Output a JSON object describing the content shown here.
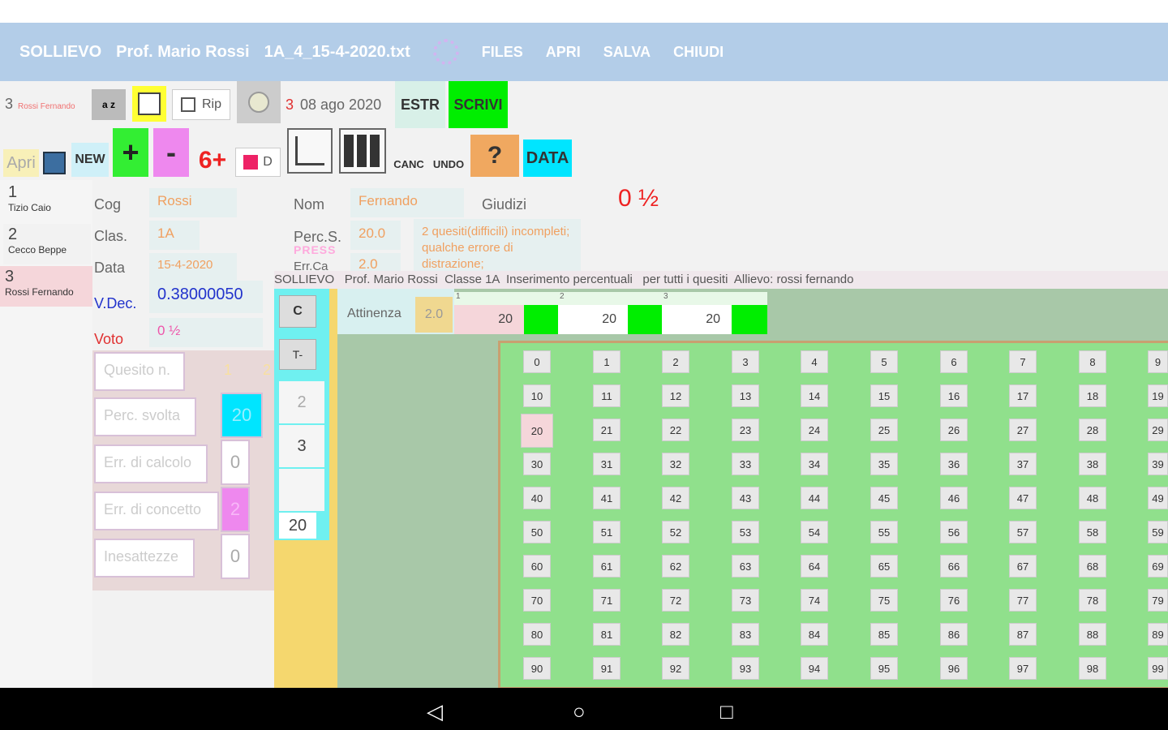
{
  "appbar": {
    "title": "SOLLIEVO",
    "teacher": "Prof. Mario Rossi",
    "file": "1A_4_15-4-2020.txt",
    "menu": [
      "FILES",
      "APRI",
      "SALVA",
      "CHIUDI"
    ]
  },
  "toolbar": {
    "count": "3",
    "current_student": "Rossi Fernando",
    "az_label": "a z",
    "rip_label": "Rip",
    "date_num": "3",
    "date_text": "08 ago 2020",
    "estr_label": "ESTR",
    "scrivi_label": "SCRIVI",
    "apri_label": "Apri",
    "new_label": "NEW",
    "plus_label": "+",
    "minus_label": "-",
    "six_plus_label": "6+",
    "d_label": "D",
    "canc_label": "CANC",
    "undo_label": "UNDO",
    "help_label": "?",
    "data_label": "DATA"
  },
  "students": [
    {
      "num": "1",
      "name": "Tizio Caio"
    },
    {
      "num": "2",
      "name": "Cecco Beppe"
    },
    {
      "num": "3",
      "name": "Rossi Fernando"
    }
  ],
  "form": {
    "cog_label": "Cog",
    "cog_value": "Rossi",
    "clas_label": "Clas.",
    "clas_value": "1A",
    "data_label": "Data",
    "data_value": "15-4-2020",
    "vdec_label": "V.Dec.",
    "vdec_value": "0.38000050",
    "voto_label": "Voto",
    "voto_value": "0 ½",
    "nom_label": "Nom",
    "nom_value": "Fernando",
    "percs_label": "Perc.S.",
    "percs_value": "20.0",
    "press_label": "PRESS",
    "errca_label": "Err.Ca",
    "errca_value": "2.0",
    "giudizi_label": "Giudizi",
    "giudizi_text": "2 quesiti(difficili) incompleti; qualche errore di distrazione;",
    "grade": "0 ½"
  },
  "inputs": {
    "quesito": "Quesito n.",
    "perc_svolta": "Perc. svolta",
    "err_calcolo": "Err. di calcolo",
    "err_concetto": "Err. di concetto",
    "inesattezze": "Inesattezze",
    "col1": "1",
    "col2": "2",
    "perc_value": "20",
    "calc_value": "0",
    "conc_value": "2",
    "ines_value": "0"
  },
  "overlay": {
    "header": "SOLLIEVO   Prof. Mario Rossi  Classe 1A  Inserimento percentuali   per tutti i quesiti  Allievo: rossi fernando",
    "c_label": "C",
    "t_label": "T-",
    "n2": "2",
    "n3": "3",
    "n20": "20",
    "attinenza_label": "Attinenza",
    "attinenza_value": "2.0",
    "q_headers": [
      "1",
      "2",
      "3"
    ],
    "q_values": [
      "20",
      "20",
      "20"
    ]
  },
  "grid": {
    "selected": 20,
    "cells": [
      "0",
      "1",
      "2",
      "3",
      "4",
      "5",
      "6",
      "7",
      "8",
      "9",
      "10",
      "11",
      "12",
      "13",
      "14",
      "15",
      "16",
      "17",
      "18",
      "19",
      "20",
      "21",
      "22",
      "23",
      "24",
      "25",
      "26",
      "27",
      "28",
      "29",
      "30",
      "31",
      "32",
      "33",
      "34",
      "35",
      "36",
      "37",
      "38",
      "39",
      "40",
      "41",
      "42",
      "43",
      "44",
      "45",
      "46",
      "47",
      "48",
      "49",
      "50",
      "51",
      "52",
      "53",
      "54",
      "55",
      "56",
      "57",
      "58",
      "59",
      "60",
      "61",
      "62",
      "63",
      "64",
      "65",
      "66",
      "67",
      "68",
      "69",
      "70",
      "71",
      "72",
      "73",
      "74",
      "75",
      "76",
      "77",
      "78",
      "79",
      "80",
      "81",
      "82",
      "83",
      "84",
      "85",
      "86",
      "87",
      "88",
      "89",
      "90",
      "91",
      "92",
      "93",
      "94",
      "95",
      "96",
      "97",
      "98",
      "99"
    ]
  },
  "navbar": {
    "back": "◁",
    "home": "○",
    "recent": "□"
  },
  "colors": {
    "appbar": "#b3cde8",
    "grid_bg": "#90e08c",
    "accent_green": "#00ee00",
    "accent_cyan": "#00e5ff",
    "pink": "#ee88ee"
  }
}
